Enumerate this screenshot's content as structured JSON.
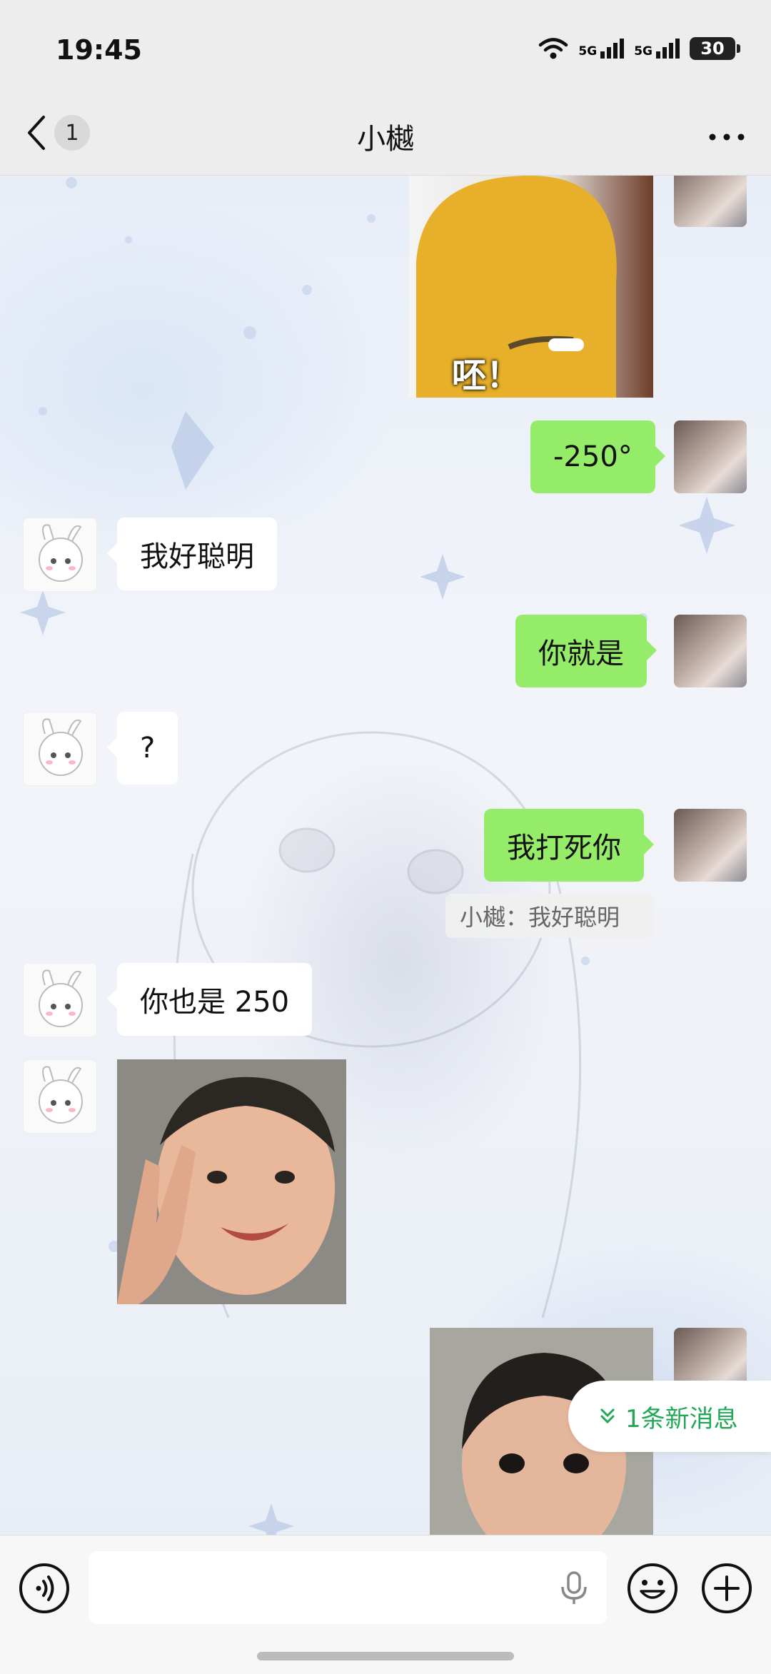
{
  "status_bar": {
    "time": "19:45",
    "signal1": "5G",
    "signal2": "5G",
    "battery": "30"
  },
  "header": {
    "back_count": "1",
    "title": "小樾"
  },
  "messages": {
    "m1": {
      "text": "-250°"
    },
    "m2": {
      "text": "我好聪明"
    },
    "m3": {
      "text": "你就是"
    },
    "m4": {
      "text": "?"
    },
    "m5": {
      "text": "我打死你",
      "quote": "小樾：我好聪明"
    },
    "m6": {
      "text": "你也是 250"
    },
    "sticker1_caption": "呸！"
  },
  "new_message_toast": {
    "label": "1条新消息"
  },
  "input_bar": {
    "placeholder": ""
  },
  "colors": {
    "my_bubble": "#95ec69",
    "other_bubble": "#ffffff",
    "accent": "#20a857"
  }
}
